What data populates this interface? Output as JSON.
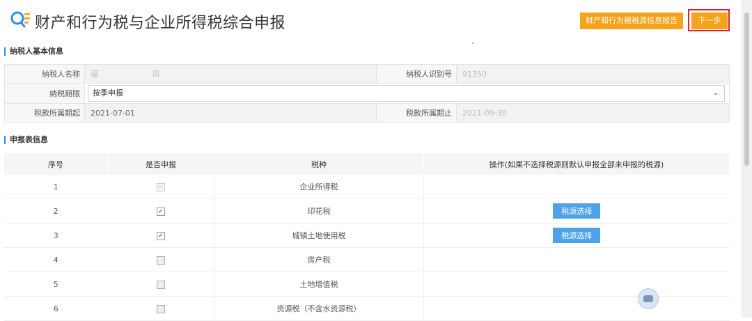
{
  "header": {
    "title": "财产和行为税与企业所得税综合申报",
    "report_button": "财产和行为税税源信息报告",
    "next_button": "下一步"
  },
  "sections": {
    "basic_info": "纳税人基本信息",
    "declaration_info": "申报表信息"
  },
  "taxpayer": {
    "name_label": "纳税人名称",
    "name_value": "福　　　　　　　司",
    "id_label": "纳税人识别号",
    "id_value": "91350",
    "period_label": "纳税期限",
    "period_value": "按季申报",
    "start_label": "税款所属期起",
    "start_value": "2021-07-01",
    "end_label": "税款所属期止",
    "end_value": "2021-09-30"
  },
  "table": {
    "headers": [
      "序号",
      "是否申报",
      "税种",
      "操作(如果不选择税源则默认申报全部未申报的税源)"
    ],
    "rows": [
      {
        "no": "1",
        "checked": true,
        "disabled": true,
        "tax": "企业所得税",
        "action": ""
      },
      {
        "no": "2",
        "checked": true,
        "disabled": false,
        "tax": "印花税",
        "action": "税源选择"
      },
      {
        "no": "3",
        "checked": true,
        "disabled": false,
        "tax": "城镇土地使用税",
        "action": "税源选择"
      },
      {
        "no": "4",
        "checked": false,
        "disabled": false,
        "tax": "房产税",
        "action": ""
      },
      {
        "no": "5",
        "checked": false,
        "disabled": false,
        "tax": "土地增值税",
        "action": ""
      },
      {
        "no": "6",
        "checked": false,
        "disabled": false,
        "tax": "资源税（不含水资源税）",
        "action": ""
      }
    ]
  },
  "icons": {
    "logo": "search-list-icon",
    "dropdown": "chevron-down-icon",
    "floating": "robot-assistant-icon"
  },
  "colors": {
    "accent_orange": "#f7a21b",
    "accent_blue": "#4da3ea",
    "highlight_red": "#e51c23"
  }
}
